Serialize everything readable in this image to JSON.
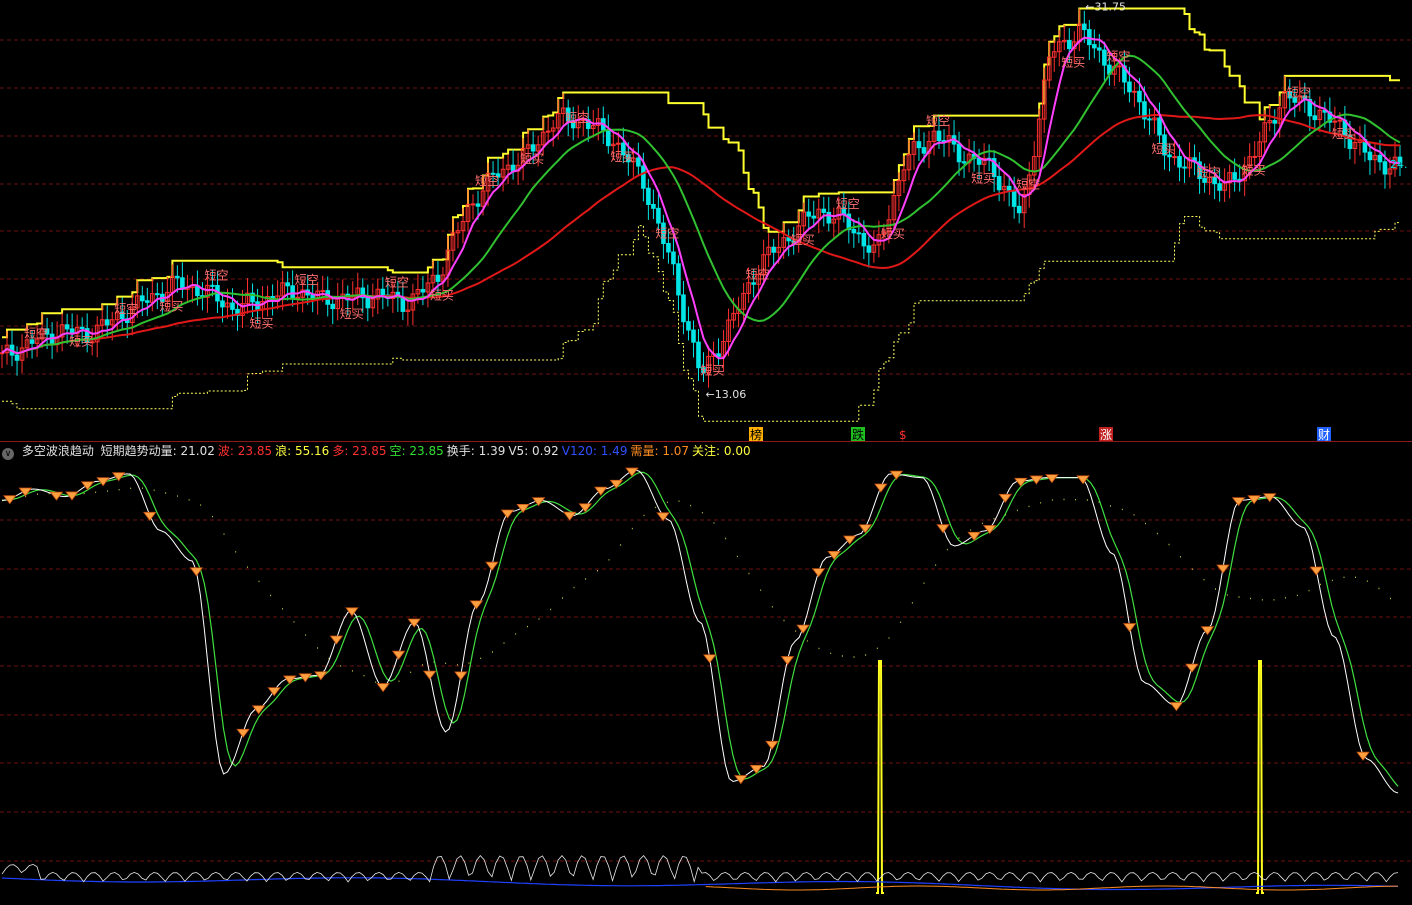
{
  "indicator_bar": {
    "toggle_icon": "chevron-down-icon",
    "name": "多空波浪趋动",
    "fields": [
      {
        "label": "短期趋势动量:",
        "value": "21.02",
        "color": "#e0e0e0"
      },
      {
        "label": "波:",
        "value": "23.85",
        "color": "#ff3030"
      },
      {
        "label": "浪:",
        "value": "55.16",
        "color": "#ffff40"
      },
      {
        "label": "多:",
        "value": "23.85",
        "color": "#ff3030"
      },
      {
        "label": "空:",
        "value": "23.85",
        "color": "#30e030"
      },
      {
        "label": "换手:",
        "value": "1.39",
        "color": "#e0e0e0"
      },
      {
        "label": "V5:",
        "value": "0.92",
        "color": "#e0e0e0"
      },
      {
        "label": "V120:",
        "value": "1.49",
        "color": "#3050ff"
      },
      {
        "label": "需量:",
        "value": "1.07",
        "color": "#ff8c20"
      },
      {
        "label": "关注:",
        "value": "0.00",
        "color": "#ffff40"
      }
    ]
  },
  "colors": {
    "bg": "#000000",
    "grid": "#6e1010",
    "up": "#ff3030",
    "down": "#00e5e5",
    "ma_short": "#ff40ff",
    "ma_mid": "#30c030",
    "ma_long": "#e01818",
    "resistance": "#ffff30",
    "support": "#ffff60",
    "signal_text": "#ff7070",
    "diamond": "#ffa040",
    "osc_fast": "#ffffff",
    "osc_slow": "#40e040",
    "osc_dots": "#e8e850"
  },
  "main_chart": {
    "price_high_label": "31.75",
    "price_low_label": "13.06",
    "right_price_label": "24.",
    "signal_labels": [
      "短空",
      "短买",
      "多"
    ],
    "bottom_marks": [
      {
        "text": "榜",
        "bg": "#ffb000",
        "fg": "#000"
      },
      {
        "text": "跌",
        "bg": "#20c020",
        "fg": "#000"
      },
      {
        "text": "$",
        "bg": "#000",
        "fg": "#ff3030"
      },
      {
        "text": "涨",
        "bg": "#c02020",
        "fg": "#fff"
      },
      {
        "text": "财",
        "bg": "#2060ff",
        "fg": "#fff"
      }
    ]
  },
  "chart_data": [
    {
      "type": "line",
      "title": "",
      "xlabel": "",
      "ylabel": "",
      "ylim": [
        12,
        33
      ],
      "series": [
        {
          "name": "",
          "values": [
            14.8,
            15.6,
            16.2,
            16.0,
            16.9,
            17.8,
            18.6,
            18.2,
            17.3,
            17.8,
            18.3,
            17.8,
            17.9,
            18.0,
            17.6,
            19.1,
            22.5,
            24.3,
            25.2,
            27.1,
            27.0,
            26.0,
            24.0,
            19.5,
            13.8,
            16.5,
            19.6,
            21.0,
            22.4,
            21.8,
            20.1,
            24.9,
            26.3,
            25.2,
            24.6,
            22.0,
            30.5,
            31.6,
            29.9,
            28.2,
            25.3,
            24.4,
            23.5,
            25.3,
            28.3,
            27.6,
            26.6,
            25.0,
            24.6
          ]
        }
      ]
    },
    {
      "type": "line",
      "title": "",
      "ylim": [
        0,
        100
      ],
      "series": [
        {
          "name": "",
          "values": [
            92,
            95,
            93,
            97,
            99,
            84,
            76,
            20,
            37,
            45,
            46,
            63,
            43,
            60,
            31,
            65,
            89,
            92,
            88,
            95,
            100,
            87,
            60,
            18,
            22,
            55,
            77,
            83,
            99,
            98,
            80,
            84,
            97,
            98,
            98,
            78,
            44,
            38,
            58,
            92,
            93,
            85,
            56,
            24,
            15
          ]
        }
      ]
    }
  ]
}
